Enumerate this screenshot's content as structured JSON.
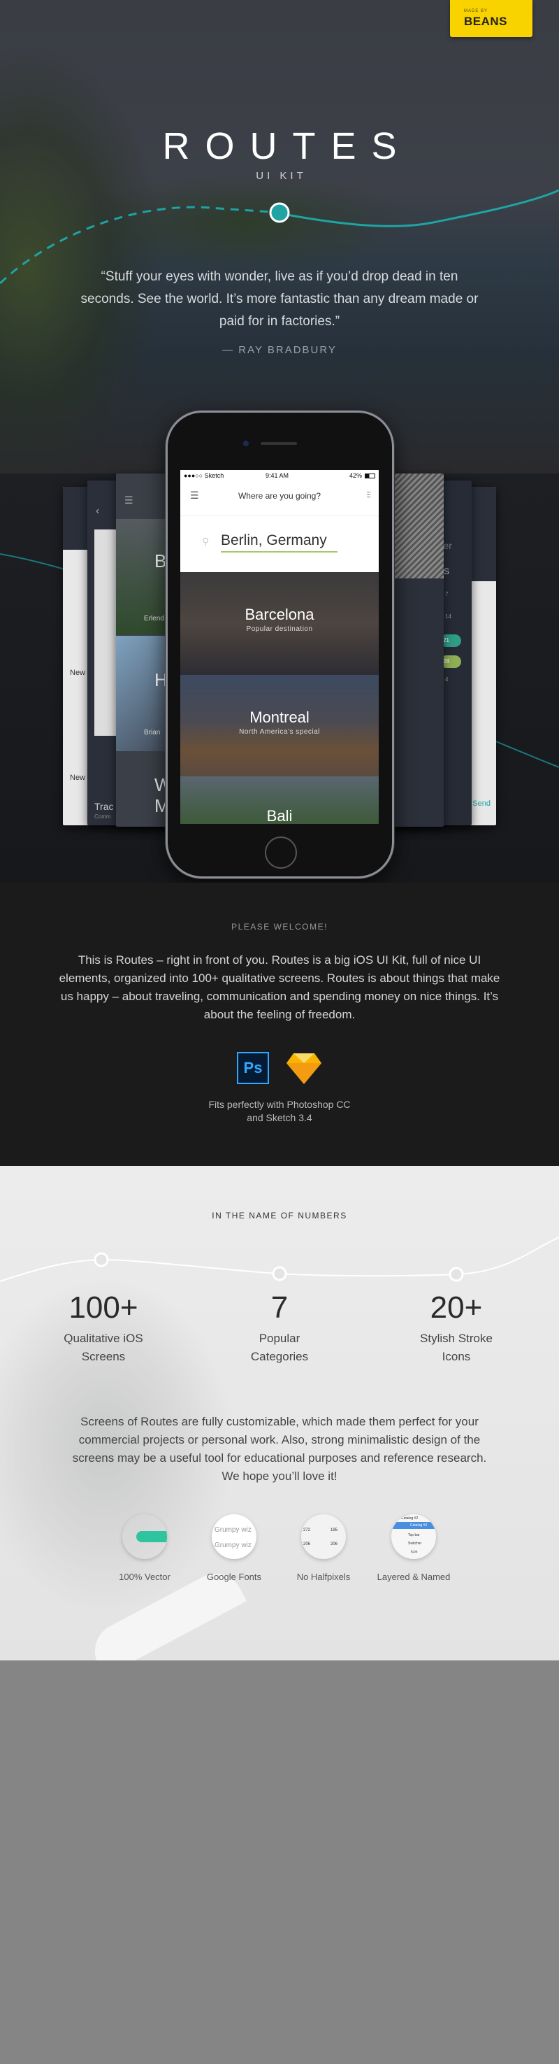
{
  "badge": {
    "small": "MADE BY",
    "brand": "BEANS",
    "color": "#f9d300"
  },
  "hero": {
    "title": "ROUTES",
    "subtitle": "UI KIT",
    "quote": "“Stuff your eyes with wonder, live as if you’d drop dead in ten seconds. See the world. It’s more fantastic than any dream made or paid for in factories.”",
    "author": "— RAY BRADBURY",
    "accent": "#1fa3a3"
  },
  "phone": {
    "status": {
      "carrier": "●●●○○ Sketch",
      "time": "9:41 AM",
      "battery": "42%"
    },
    "header": {
      "title": "Where are you going?",
      "menu_icon": "hamburger-icon",
      "filter_icon": "sliders-icon"
    },
    "search": {
      "value": "Berlin, Germany",
      "underline": "#a8c66c"
    },
    "destinations": [
      {
        "name": "Barcelona",
        "desc": "Popular destination"
      },
      {
        "name": "Montreal",
        "desc": "North America’s special"
      },
      {
        "name": "Bali",
        "desc": ""
      }
    ],
    "side_cards": {
      "left": [
        "New",
        "New",
        "Trac",
        "Comm",
        "Erlend",
        "Brian",
        "B",
        "H",
        "W",
        "M"
      ],
      "right": [
        "mber",
        "S",
        "7",
        "14",
        "21",
        "28",
        "4",
        "Send",
        "t a"
      ]
    }
  },
  "welcome": {
    "heading": "PLEASE WELCOME!",
    "body": "This is Routes – right in front of you. Routes is a big iOS UI Kit, full of nice UI elements, organized into 100+ qualitative screens. Routes is about things that make us happy – about traveling, communication and spending money on nice things. It’s about the feeling of freedom.",
    "tools": [
      "Ps",
      "sketch-icon"
    ],
    "caption_1": "Fits perfectly with Photoshop CC",
    "caption_2": "and Sketch 3.4"
  },
  "numbers": {
    "heading": "IN THE NAME OF NUMBERS",
    "items": [
      {
        "value": "100+",
        "label_1": "Qualitative iOS",
        "label_2": "Screens"
      },
      {
        "value": "7",
        "label_1": "Popular",
        "label_2": "Categories"
      },
      {
        "value": "20+",
        "label_1": "Stylish Stroke",
        "label_2": "Icons"
      }
    ],
    "body": "Screens of Routes are fully customizable, which made them perfect for your commercial projects or personal work. Also, strong minimalistic design of the screens may be a useful tool for educational purposes and reference research. We hope you’ll love it!",
    "features": [
      {
        "label": "100% Vector"
      },
      {
        "label": "Google Fonts",
        "sample": "Grumpy wiz"
      },
      {
        "label": "No Halfpixels",
        "values": [
          "272",
          "195",
          "206",
          "206"
        ]
      },
      {
        "label": "Layered & Named",
        "layers": [
          "Catalog #2",
          "Catalog #3",
          "Top bar",
          "Switcher",
          "Icon"
        ]
      }
    ]
  }
}
